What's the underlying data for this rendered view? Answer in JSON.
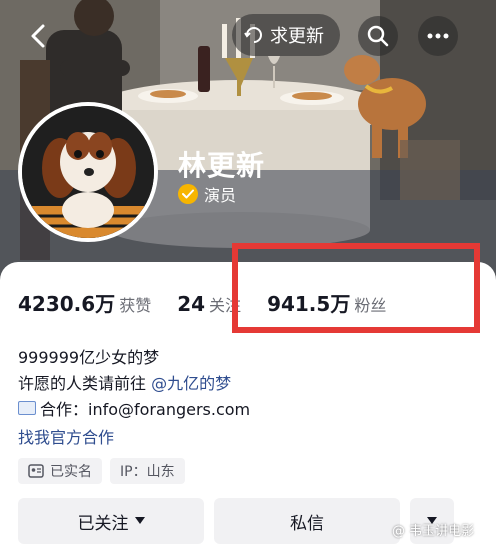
{
  "header": {
    "back_icon": "chevron-left-icon",
    "chip_text": "求更新",
    "chip_icon": "refresh-hint-icon",
    "search_icon": "search-icon",
    "more_icon": "more-horizontal-icon"
  },
  "profile": {
    "name": "林更新",
    "role": "演员",
    "role_badge_color": "#f7b500"
  },
  "stats": {
    "likes_value": "4230.6万",
    "likes_label": "获赞",
    "following_value": "24",
    "following_label": "关注",
    "followers_value": "941.5万",
    "followers_label": "粉丝"
  },
  "bio": {
    "line1": "999999亿少女的梦",
    "line2_prefix": "许愿的人类请前往 ",
    "line2_link": "@九亿的梦",
    "line3": "合作：info@forangers.com",
    "cooperate_link": "找我官方合作"
  },
  "tags": {
    "verified": "已实名",
    "ip": "IP：山东"
  },
  "actions": {
    "follow": "已关注",
    "message": "私信"
  },
  "watermark": "@ 韦玉讲电影",
  "colors": {
    "highlight": "#e53935",
    "link": "#2f4d8f"
  }
}
